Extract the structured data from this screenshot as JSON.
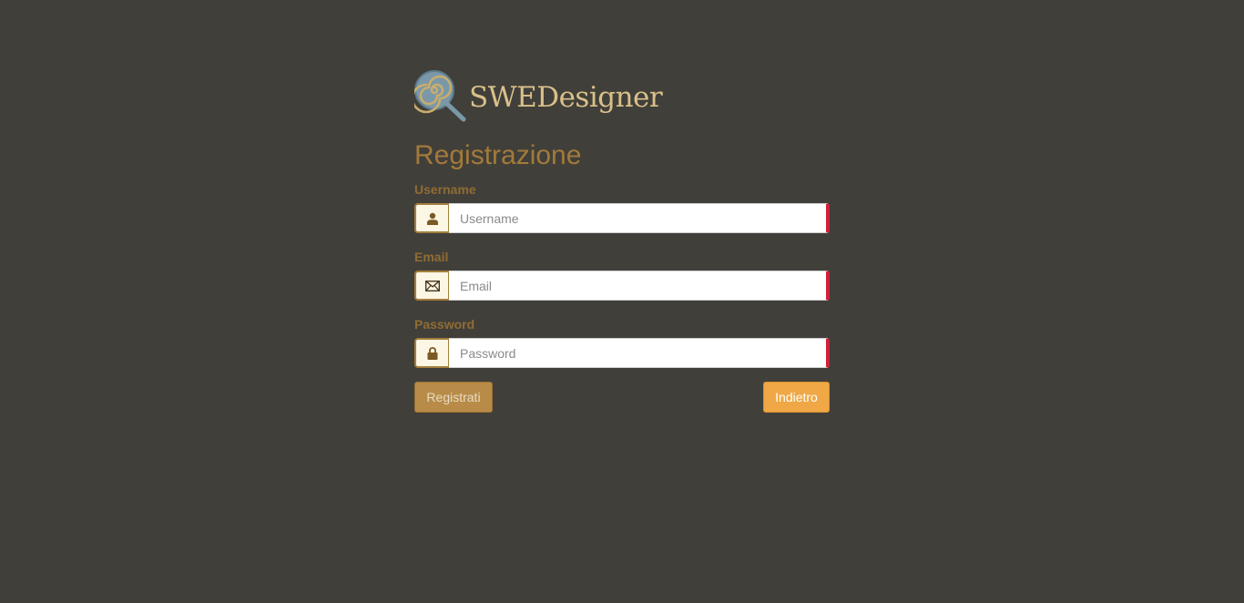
{
  "brand": {
    "name": "SWEDesigner",
    "logo_icon": "lollipop-magnifier-icon"
  },
  "form": {
    "title": "Registrazione",
    "fields": [
      {
        "label": "Username",
        "placeholder": "Username",
        "value": "",
        "icon": "user-icon"
      },
      {
        "label": "Email",
        "placeholder": "Email",
        "value": "",
        "icon": "envelope-icon"
      },
      {
        "label": "Password",
        "placeholder": "Password",
        "value": "",
        "icon": "lock-icon"
      }
    ],
    "register_label": "Registrati",
    "back_label": "Indietro"
  },
  "colors": {
    "background": "#413f3a",
    "accent": "#a27a3a",
    "invalid_marker": "#d0203a",
    "primary_button": "#efa845"
  }
}
